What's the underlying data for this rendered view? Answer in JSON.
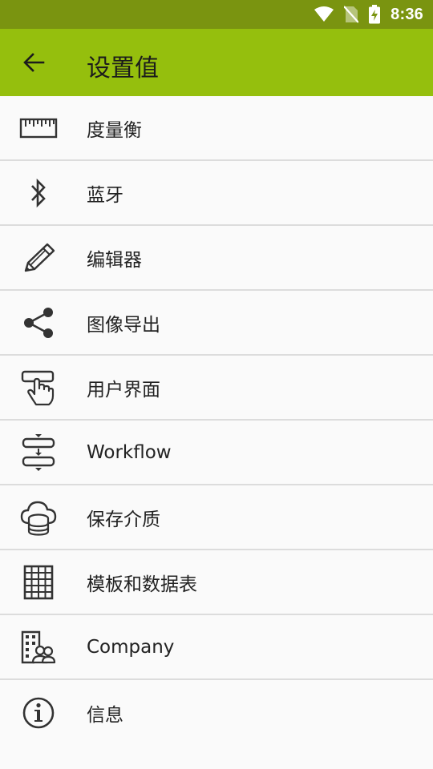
{
  "status_bar": {
    "time": "8:36",
    "icons": [
      "wifi-icon",
      "no-sim-icon",
      "battery-charging-icon"
    ]
  },
  "app_bar": {
    "title": "设置值",
    "back_icon": "arrow-left-icon",
    "color": "#95bf0d",
    "status_color": "#7a9410"
  },
  "settings": {
    "items": [
      {
        "label": "度量衡",
        "icon": "ruler-icon"
      },
      {
        "label": "蓝牙",
        "icon": "bluetooth-icon"
      },
      {
        "label": "编辑器",
        "icon": "pencil-icon"
      },
      {
        "label": "图像导出",
        "icon": "share-icon"
      },
      {
        "label": "用户界面",
        "icon": "touch-hand-icon"
      },
      {
        "label": "Workflow",
        "icon": "workflow-icon"
      },
      {
        "label": "保存介质",
        "icon": "cloud-database-icon"
      },
      {
        "label": "模板和数据表",
        "icon": "table-grid-icon"
      },
      {
        "label": "Company",
        "icon": "company-building-icon"
      },
      {
        "label": "信息",
        "icon": "info-icon"
      }
    ]
  }
}
